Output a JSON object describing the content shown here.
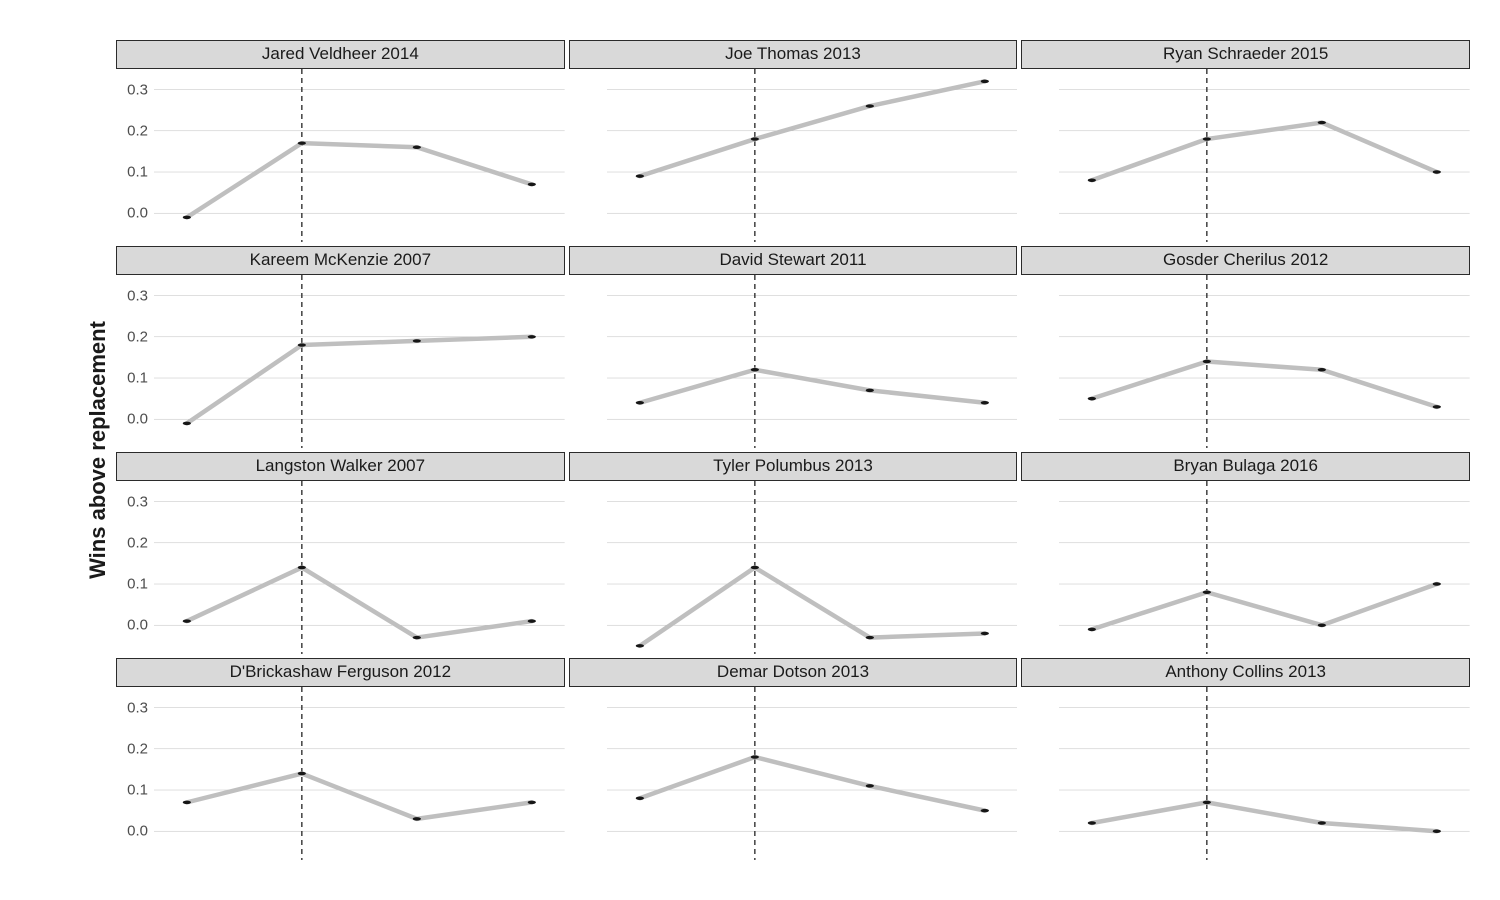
{
  "ylabel": "Wins above replacement",
  "yaxis": {
    "min": -0.07,
    "max": 0.35,
    "ticks": [
      0.0,
      0.1,
      0.2,
      0.3
    ],
    "tick_labels": [
      "0.0",
      "0.1",
      "0.2",
      "0.3"
    ]
  },
  "xaxis": {
    "indices": [
      0,
      1,
      2,
      3
    ],
    "vline_at_index": 1
  },
  "chart_data": {
    "type": "line",
    "ylabel": "Wins above replacement",
    "ylim": [
      -0.07,
      0.35
    ],
    "x_indices": [
      0,
      1,
      2,
      3
    ],
    "vline_at_index": 1,
    "panels": [
      {
        "title": "Jared Veldheer 2014",
        "values": [
          -0.01,
          0.17,
          0.16,
          0.07
        ]
      },
      {
        "title": "Joe Thomas 2013",
        "values": [
          0.09,
          0.18,
          0.26,
          0.32
        ]
      },
      {
        "title": "Ryan Schraeder 2015",
        "values": [
          0.08,
          0.18,
          0.22,
          0.1
        ]
      },
      {
        "title": "Kareem McKenzie 2007",
        "values": [
          -0.01,
          0.18,
          0.19,
          0.2
        ]
      },
      {
        "title": "David Stewart 2011",
        "values": [
          0.04,
          0.12,
          0.07,
          0.04
        ]
      },
      {
        "title": "Gosder Cherilus 2012",
        "values": [
          0.05,
          0.14,
          0.12,
          0.03
        ]
      },
      {
        "title": "Langston Walker 2007",
        "values": [
          0.01,
          0.14,
          -0.03,
          0.01
        ]
      },
      {
        "title": "Tyler Polumbus 2013",
        "values": [
          -0.05,
          0.14,
          -0.03,
          -0.02
        ]
      },
      {
        "title": "Bryan Bulaga 2016",
        "values": [
          -0.01,
          0.08,
          0.0,
          0.1
        ]
      },
      {
        "title": "D'Brickashaw Ferguson 2012",
        "values": [
          0.07,
          0.14,
          0.03,
          0.07
        ]
      },
      {
        "title": "Demar Dotson 2013",
        "values": [
          0.08,
          0.18,
          0.11,
          0.05
        ]
      },
      {
        "title": "Anthony Collins 2013",
        "values": [
          0.02,
          0.07,
          0.02,
          0.0
        ]
      }
    ]
  }
}
